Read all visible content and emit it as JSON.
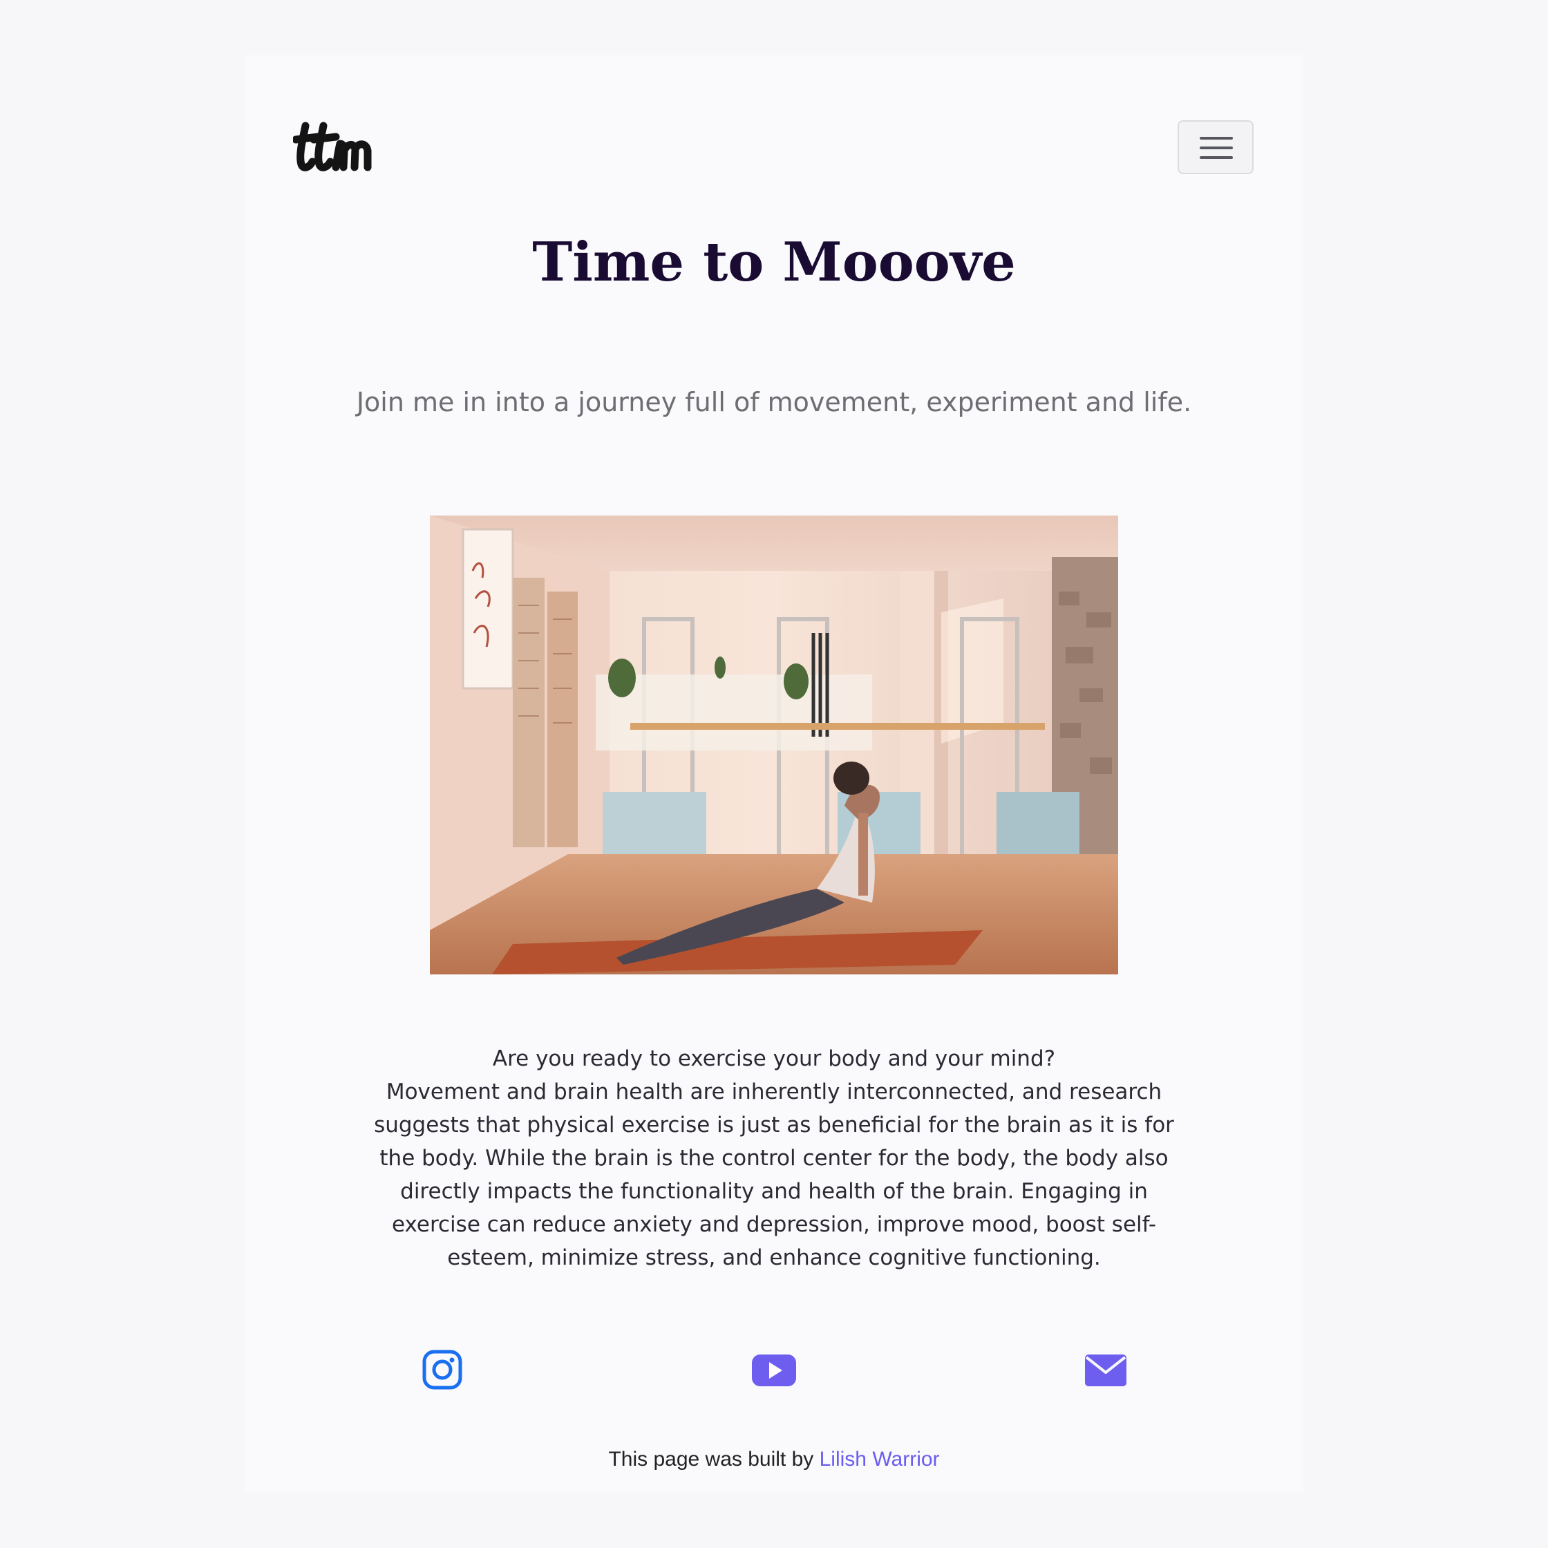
{
  "brand": {
    "logo_text": "ttm",
    "logo_icon": "ttm-script-logo"
  },
  "nav": {
    "menu_icon": "hamburger-menu-icon"
  },
  "hero": {
    "title": "Time to Mooove",
    "tagline": "Join me in into a journey full of movement, experiment and life.",
    "photo_icon": "yoga-studio-photo"
  },
  "intro": {
    "question": "Are you ready to exercise your body and your mind?",
    "paragraph": "Movement and brain health are inherently interconnected, and research suggests that physical exercise is just as beneficial for the brain as it is for the body. While the brain is the control center for the body, the body also directly impacts the functionality and health of the brain. Engaging in exercise can reduce anxiety and depression, improve mood, boost self-esteem, minimize stress, and enhance cognitive functioning."
  },
  "social": [
    {
      "icon": "instagram-icon",
      "color": "#1a6ff0"
    },
    {
      "icon": "youtube-icon",
      "color": "#6d5ef0"
    },
    {
      "icon": "envelope-icon",
      "color": "#6d5ef0"
    }
  ],
  "footer": {
    "prefix": "This page was built by",
    "author": "Lilish Warrior",
    "link_color": "#6a5cf0"
  },
  "colors": {
    "title": "#1a0b33",
    "tagline": "#6d6d72",
    "background": "#f7f7fa"
  }
}
